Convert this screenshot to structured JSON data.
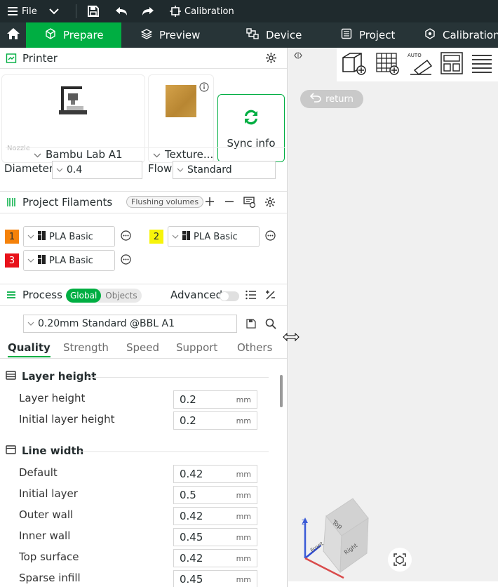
{
  "titlebar": {
    "file_label": "File",
    "calibration_label": "Calibration"
  },
  "tabs": [
    {
      "label": "Prepare",
      "icon": "cube-icon",
      "active": true
    },
    {
      "label": "Preview",
      "icon": "layers-icon"
    },
    {
      "label": "Device",
      "icon": "device-icon"
    },
    {
      "label": "Project",
      "icon": "project-icon"
    },
    {
      "label": "Calibration",
      "icon": "calibration-icon"
    }
  ],
  "printer": {
    "title": "Printer",
    "printer_name": "Bambu Lab A1",
    "plate_name": "Texture...",
    "sync_label": "Sync info",
    "nozzle_caption": "Nozzle",
    "diameter_label": "Diameter",
    "diameter_value": "0.4",
    "flow_label": "Flow",
    "flow_value": "Standard"
  },
  "filaments": {
    "title": "Project Filaments",
    "flushing_label": "Flushing volumes",
    "items": [
      {
        "num": "1",
        "color": "#f5820a",
        "name": "PLA Basic"
      },
      {
        "num": "2",
        "color": "#f7f40a",
        "name": "PLA Basic"
      },
      {
        "num": "3",
        "color": "#e8121a",
        "name": "PLA Basic"
      }
    ]
  },
  "process": {
    "title": "Process",
    "global_label": "Global",
    "objects_label": "Objects",
    "advanced_label": "Advanced",
    "preset": "0.20mm Standard @BBL A1",
    "subtabs": [
      "Quality",
      "Strength",
      "Speed",
      "Support",
      "Others"
    ],
    "groups": [
      {
        "title": "Layer height",
        "options": [
          {
            "label": "Layer height",
            "value": "0.2",
            "unit": "mm"
          },
          {
            "label": "Initial layer height",
            "value": "0.2",
            "unit": "mm"
          }
        ]
      },
      {
        "title": "Line width",
        "options": [
          {
            "label": "Default",
            "value": "0.42",
            "unit": "mm"
          },
          {
            "label": "Initial layer",
            "value": "0.5",
            "unit": "mm"
          },
          {
            "label": "Outer wall",
            "value": "0.42",
            "unit": "mm"
          },
          {
            "label": "Inner wall",
            "value": "0.45",
            "unit": "mm"
          },
          {
            "label": "Top surface",
            "value": "0.42",
            "unit": "mm"
          },
          {
            "label": "Sparse infill",
            "value": "0.45",
            "unit": "mm"
          }
        ]
      }
    ]
  },
  "viewport": {
    "return_label": "return",
    "cube_labels": {
      "top": "Top",
      "front": "Front",
      "right": "Right"
    },
    "axis_z": "Z"
  },
  "colors": {
    "accent": "#00ae42",
    "titlebar": "#1f2a2d",
    "tabbar": "#273437"
  }
}
